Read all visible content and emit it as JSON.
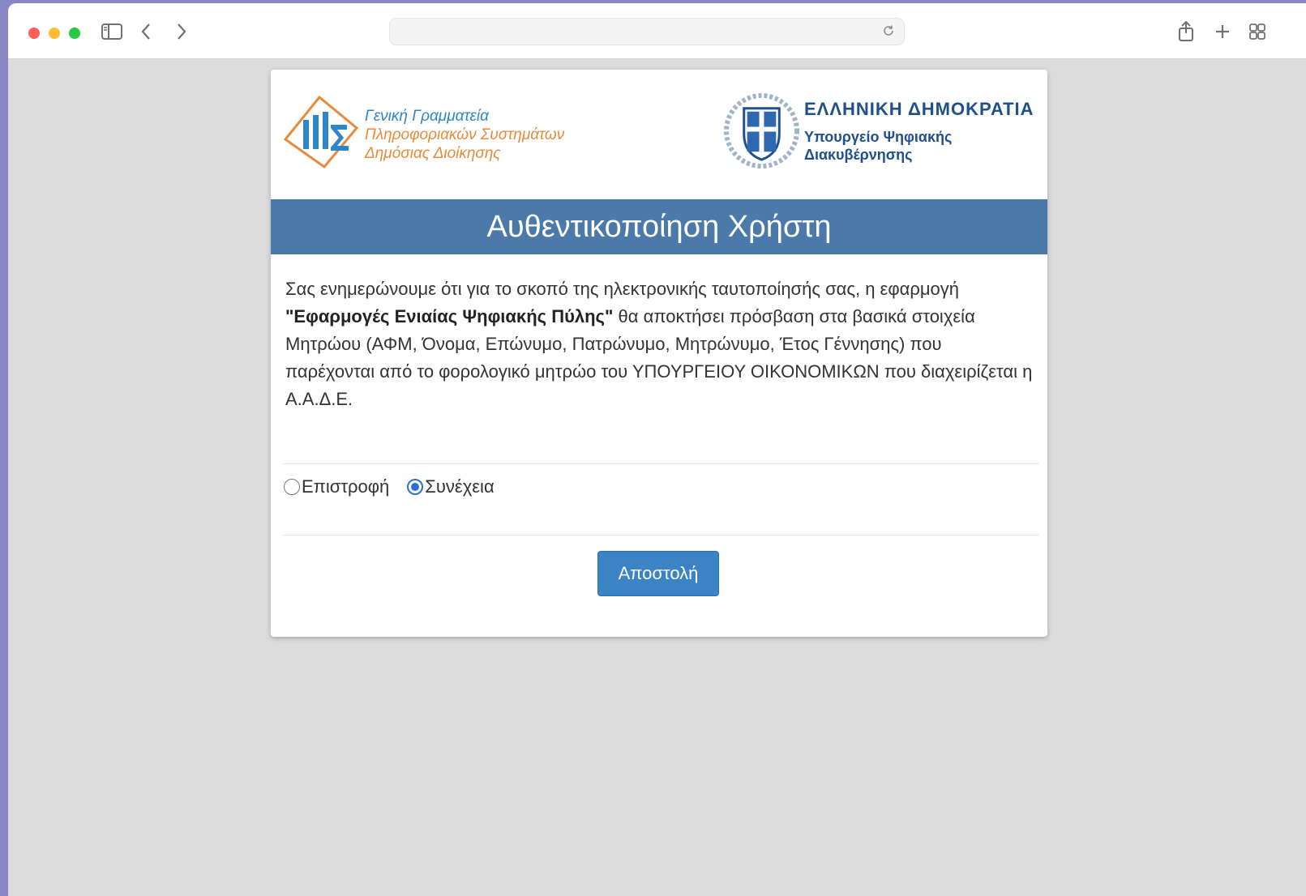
{
  "browser": {
    "icons": [
      "sidebar-icon",
      "back-icon",
      "forward-icon",
      "reload-icon",
      "share-icon",
      "new-tab-icon",
      "tab-overview-icon"
    ],
    "address": ""
  },
  "header": {
    "left_org": [
      "Γενική Γραμματεία",
      "Πληροφοριακών Συστημάτων",
      "Δημόσιας Διοίκησης"
    ],
    "right_title": "ΕΛΛΗΝΙΚΗ ΔΗΜΟΚΡΑΤΙΑ",
    "right_ministry": [
      "Υπουργείο Ψηφιακής",
      "Διακυβέρνησης"
    ]
  },
  "title": "Αυθεντικοποίηση Χρήστη",
  "message": {
    "intro": "Σας ενημερώνουμε ότι για το σκοπό της ηλεκτρονικής ταυτοποίησής σας, η εφαρμογή ",
    "app_name": "\"Εφαρμογές Ενιαίας Ψηφιακής Πύλης\"",
    "rest": " θα αποκτήσει πρόσβαση στα βασικά στοιχεία Μητρώου (ΑΦΜ, Όνομα, Επώνυμο, Πατρώνυμο, Μητρώνυμο, Έτος Γέννησης) που παρέχονται από το φορολογικό μητρώο του ΥΠΟΥΡΓΕΙΟΥ ΟΙΚΟΝΟΜΙΚΩΝ που διαχειρίζεται η Α.Α.Δ.Ε."
  },
  "choices": [
    {
      "label": "Επιστροφή",
      "checked": false
    },
    {
      "label": "Συνέχεια",
      "checked": true
    }
  ],
  "submit_label": "Αποστολή",
  "colors": {
    "title_bar": "#4a79aa",
    "button": "#3a83c4",
    "radio_selected": "#2f6fd0"
  }
}
